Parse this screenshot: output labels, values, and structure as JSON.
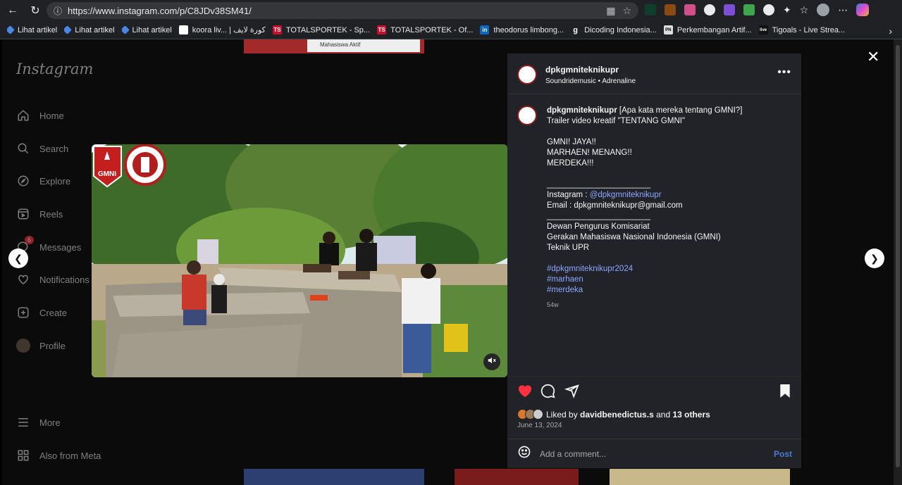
{
  "browser": {
    "url": "https://www.instagram.com/p/C8JDv38SM41/",
    "bookmarks": [
      {
        "label": "Lihat artikel"
      },
      {
        "label": "Lihat artikel"
      },
      {
        "label": "Lihat artikel"
      },
      {
        "label": "koora liv... | كورة لايف"
      },
      {
        "label": "TOTALSPORTEK - Sp..."
      },
      {
        "label": "TOTALSPORTEK - Of..."
      },
      {
        "label": "theodorus limbong..."
      },
      {
        "label": "Dicoding Indonesia..."
      },
      {
        "label": "Perkembangan Artif..."
      },
      {
        "label": "Tigoals - Live Strea..."
      }
    ]
  },
  "sidebar": {
    "logo": "Instagram",
    "items": [
      {
        "label": "Home"
      },
      {
        "label": "Search"
      },
      {
        "label": "Explore"
      },
      {
        "label": "Reels"
      },
      {
        "label": "Messages",
        "badge": "6"
      },
      {
        "label": "Notifications"
      },
      {
        "label": "Create"
      },
      {
        "label": "Profile"
      }
    ],
    "more": "More",
    "also_from": "Also from Meta"
  },
  "background": {
    "top_thumb_text": "Mahasiswa Aktif"
  },
  "post": {
    "username": "dpkgmniteknikupr",
    "audio": "Soundridemusic • Adrenaline",
    "caption_lines": [
      "[Apa kata mereka tentang GMNI?]",
      "Trailer video kreatif \"TENTANG GMNI\"",
      "",
      "GMNI! JAYA!!",
      "MARHAEN! MENANG!!",
      "MERDEKA!!!",
      "",
      "_______________________",
      "Instagram : ",
      "Email : dpkgmniteknikupr@gmail.com",
      "_______________________",
      "Dewan Pengurus Komisariat",
      "Gerakan Mahasiswa Nasional Indonesia (GMNI)",
      "Teknik UPR",
      "",
      "#dpkgmniteknikupr2024",
      "#marhaen",
      "#merdeka"
    ],
    "instagram_handle": "@dpkgmniteknikupr",
    "age": "54w",
    "liked_prefix": "Liked by ",
    "liked_user": "davidbenedictus.s",
    "liked_and": " and ",
    "liked_others": "13 others",
    "date": "June 13, 2024",
    "comment_placeholder": "Add a comment...",
    "post_label": "Post"
  },
  "colors": {
    "panel_bg": "#212328",
    "like_red": "#ff3040",
    "link_blue": "#8ea6ff",
    "post_blue": "#4a7bd0"
  }
}
